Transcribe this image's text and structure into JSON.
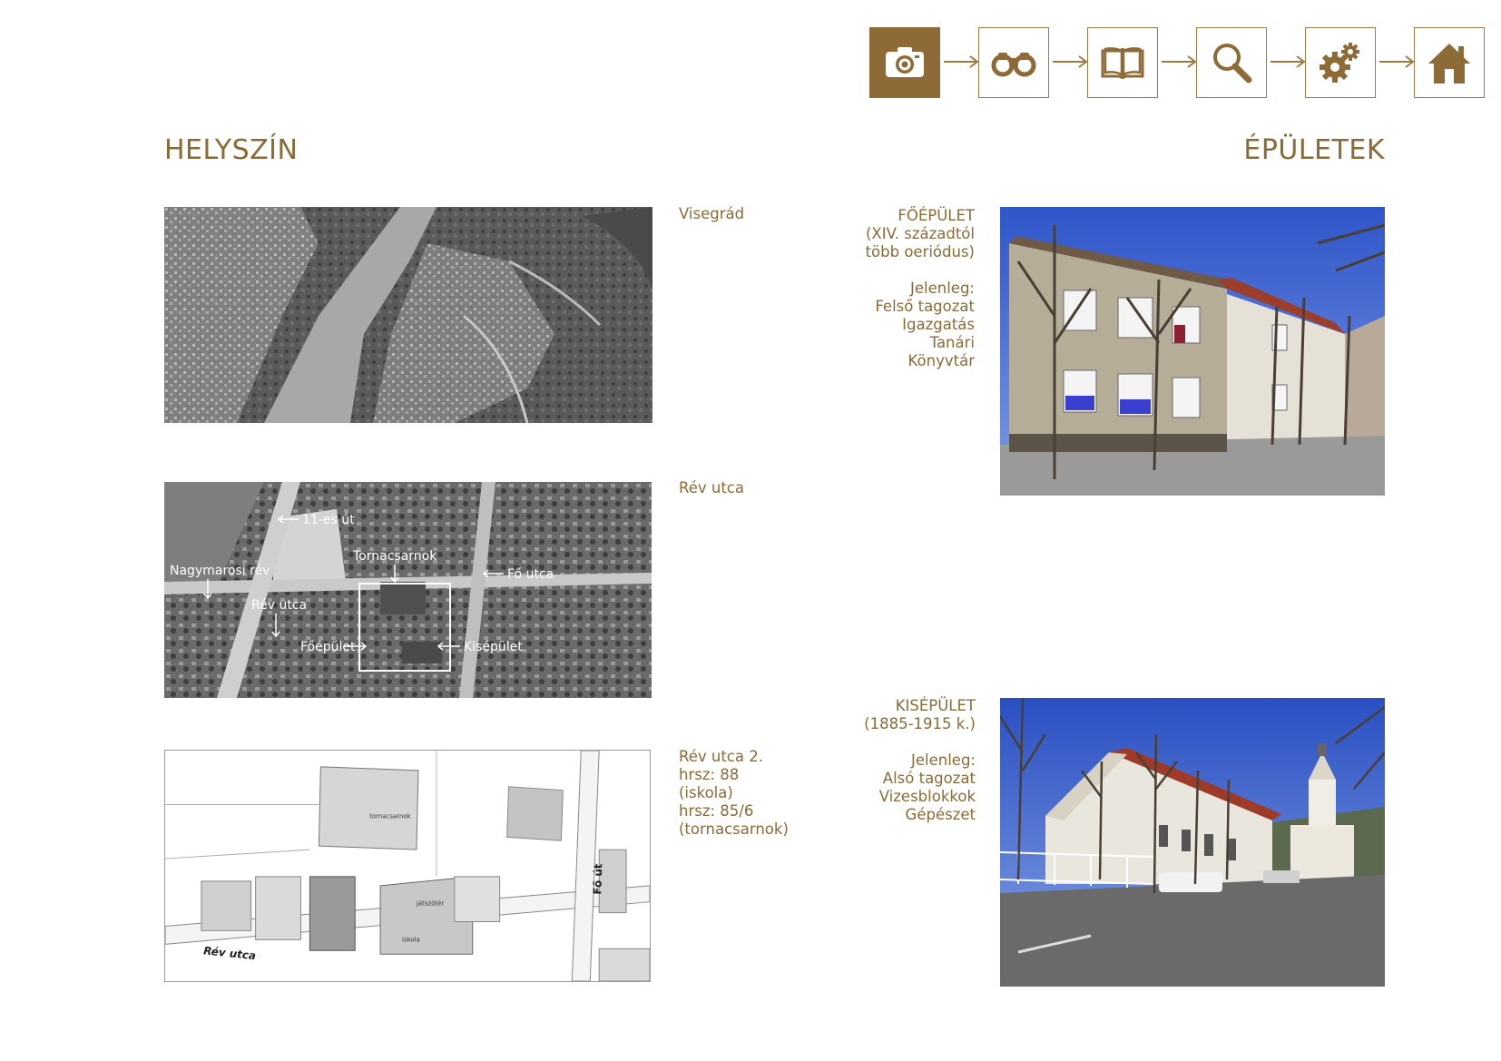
{
  "nav": {
    "buttons": [
      {
        "icon": "camera-icon",
        "active": true
      },
      {
        "icon": "binoculars-icon",
        "active": false
      },
      {
        "icon": "book-icon",
        "active": false
      },
      {
        "icon": "magnifier-icon",
        "active": false
      },
      {
        "icon": "gears-icon",
        "active": false
      },
      {
        "icon": "home-icon",
        "active": false
      }
    ]
  },
  "left": {
    "title": "HELYSZÍN",
    "captions": {
      "first": "Visegrád",
      "second": "Rév utca",
      "third": [
        "Rév utca 2.",
        "hrsz: 88",
        "(iskola)",
        "hrsz: 85/6",
        "(tornacsarnok)"
      ]
    },
    "aerial_labels": {
      "road_11": "11-es út",
      "gym": "Tornacsarnok",
      "ferry": "Nagymarosi rév",
      "fo_utca": "Fő utca",
      "rev_utca": "Rév utca",
      "main_building": "Főépület",
      "small_building": "Kisépület"
    },
    "plan_labels": {
      "gym": "tornacsarnok",
      "school": "iskola",
      "playground": "játszótér",
      "street": "Rév utca",
      "main_road": "Fő út"
    }
  },
  "right": {
    "title": "ÉPÜLETEK",
    "main_building": {
      "lines_top": [
        "FŐÉPÜLET",
        "(XIV. századtól",
        "több oeriódus)"
      ],
      "lines_bottom": [
        "Jelenleg:",
        "Felső tagozat",
        "Igazgatás",
        "Tanári",
        "Könyvtár"
      ]
    },
    "small_building": {
      "lines_top": [
        "KISÉPÜLET",
        "(1885-1915 k.)"
      ],
      "lines_bottom": [
        "Jelenleg:",
        "Alsó tagozat",
        "Vizesblokkok",
        "Gépészet"
      ]
    }
  },
  "colors": {
    "accent": "#8d6a36",
    "text": "#8a6a37"
  }
}
